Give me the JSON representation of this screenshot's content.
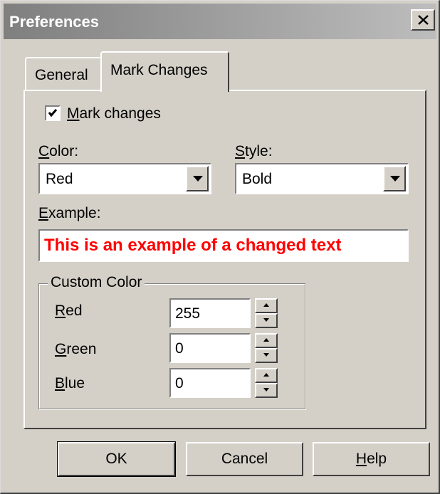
{
  "window": {
    "title": "Preferences"
  },
  "tabs": [
    {
      "label": "General",
      "active": false
    },
    {
      "label": "Mark Changes",
      "active": true
    }
  ],
  "mark_changes": {
    "label_prefix": "",
    "label_underline": "M",
    "label_rest": "ark changes",
    "checked": true
  },
  "color": {
    "label_underline": "C",
    "label_rest": "olor:",
    "value": "Red"
  },
  "style": {
    "label_underline": "S",
    "label_rest": "tyle:",
    "value": "Bold"
  },
  "example": {
    "label_underline": "E",
    "label_rest": "xample:",
    "text": "This is an example of a changed text",
    "text_color": "#ff0000"
  },
  "custom_color": {
    "legend": "Custom Color",
    "red": {
      "label_underline": "R",
      "label_rest": "ed",
      "value": "255"
    },
    "green": {
      "label_underline": "G",
      "label_rest": "reen",
      "value": "0"
    },
    "blue": {
      "label_underline": "B",
      "label_rest": "lue",
      "value": "0"
    }
  },
  "buttons": {
    "ok": "OK",
    "cancel": "Cancel",
    "help_underline": "H",
    "help_rest": "elp"
  },
  "colors": {
    "dialog_bg": "#d4d0c8",
    "title_gradient_start": "#7f7f7f",
    "title_gradient_end": "#bdbdbd"
  },
  "icons": {
    "close": "close-x-icon",
    "dropdown": "triangle-down-icon",
    "spin_up": "triangle-up-icon",
    "spin_down": "triangle-down-icon",
    "check": "checkmark-icon"
  }
}
